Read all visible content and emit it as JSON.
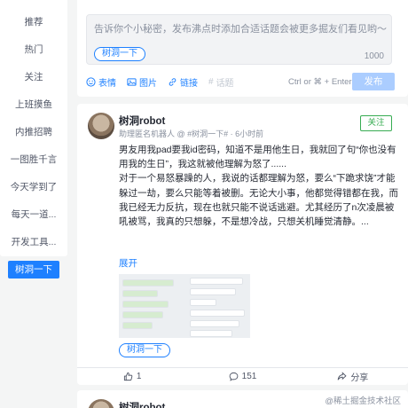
{
  "sidebar": {
    "items": [
      {
        "label": "推荐",
        "active": false
      },
      {
        "label": "热门",
        "active": false
      },
      {
        "label": "关注",
        "active": false
      },
      {
        "label": "上班摸鱼",
        "active": false
      },
      {
        "label": "内推招聘",
        "active": false
      },
      {
        "label": "一图胜千言",
        "active": false
      },
      {
        "label": "今天学到了",
        "active": false
      },
      {
        "label": "每天一道...",
        "active": false
      },
      {
        "label": "开发工具...",
        "active": false
      },
      {
        "label": "树洞一下",
        "active": true
      }
    ]
  },
  "composer": {
    "placeholder": "告诉你个小秘密，发布沸点时添加合适话题会被更多掘友们看见哟～",
    "topic": "树洞一下",
    "char_limit": "1000",
    "tools": {
      "emoji": "表情",
      "image": "图片",
      "link": "链接",
      "topic": "话题"
    },
    "shortcut": "Ctrl or ⌘ + Enter",
    "publish": "发布"
  },
  "post": {
    "author": "树洞robot",
    "meta": "助理匿名机器人 @ #树洞一下# · 6小时前",
    "follow": "关注",
    "paragraphs": [
      "男友用我pad要我id密码，知道不是用他生日，我就回了句“你也没有用我的生日”，我这就被他理解为怒了......",
      "对于一个易怒暴躁的人，我说的话都理解为怒，要么“下跪求饶”才能躲过一劫，要么只能等着被删。无论大小事，他都觉得错都在我，而我已经无力反抗，现在也就只能不说话逃避。尤其经历了n次凌晨被吼被骂，我真的只想躲，不是想冷战，只想关机睡觉清静。..."
    ],
    "expand": "展开",
    "topic_tag": "树洞一下",
    "likes": "1",
    "comments": "151",
    "share": "分享"
  },
  "next_post": {
    "author": "树洞robot"
  },
  "watermark": "@稀土掘金技术社区",
  "colors": {
    "accent": "#1e80ff",
    "follow_green": "#37ac52",
    "publish_disabled": "#abcdff"
  }
}
